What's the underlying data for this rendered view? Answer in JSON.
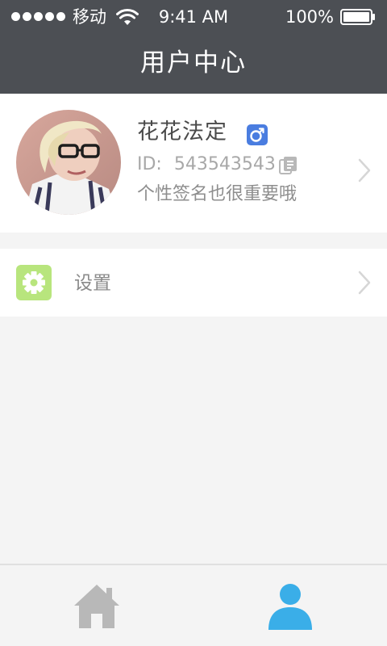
{
  "status_bar": {
    "carrier": "移动",
    "time": "9:41 AM",
    "battery": "100%"
  },
  "header": {
    "title": "用户中心"
  },
  "profile": {
    "name": "花花法定",
    "id_label": "ID:",
    "id_value": "543543543",
    "signature": "个性签名也很重要哦",
    "gender_icon": "male-symbol-icon",
    "copy_icon": "copy-icon"
  },
  "settings": {
    "label": "设置",
    "icon": "gear-icon"
  },
  "tabbar": {
    "items": [
      {
        "icon": "home-icon",
        "active": false
      },
      {
        "icon": "person-icon",
        "active": true
      }
    ]
  },
  "colors": {
    "header_bg": "#4c4f54",
    "settings_icon_bg": "#b8e57d",
    "gender_badge": "#4a7de0",
    "tab_active": "#3aaee8",
    "tab_inactive": "#b8b8b8"
  }
}
